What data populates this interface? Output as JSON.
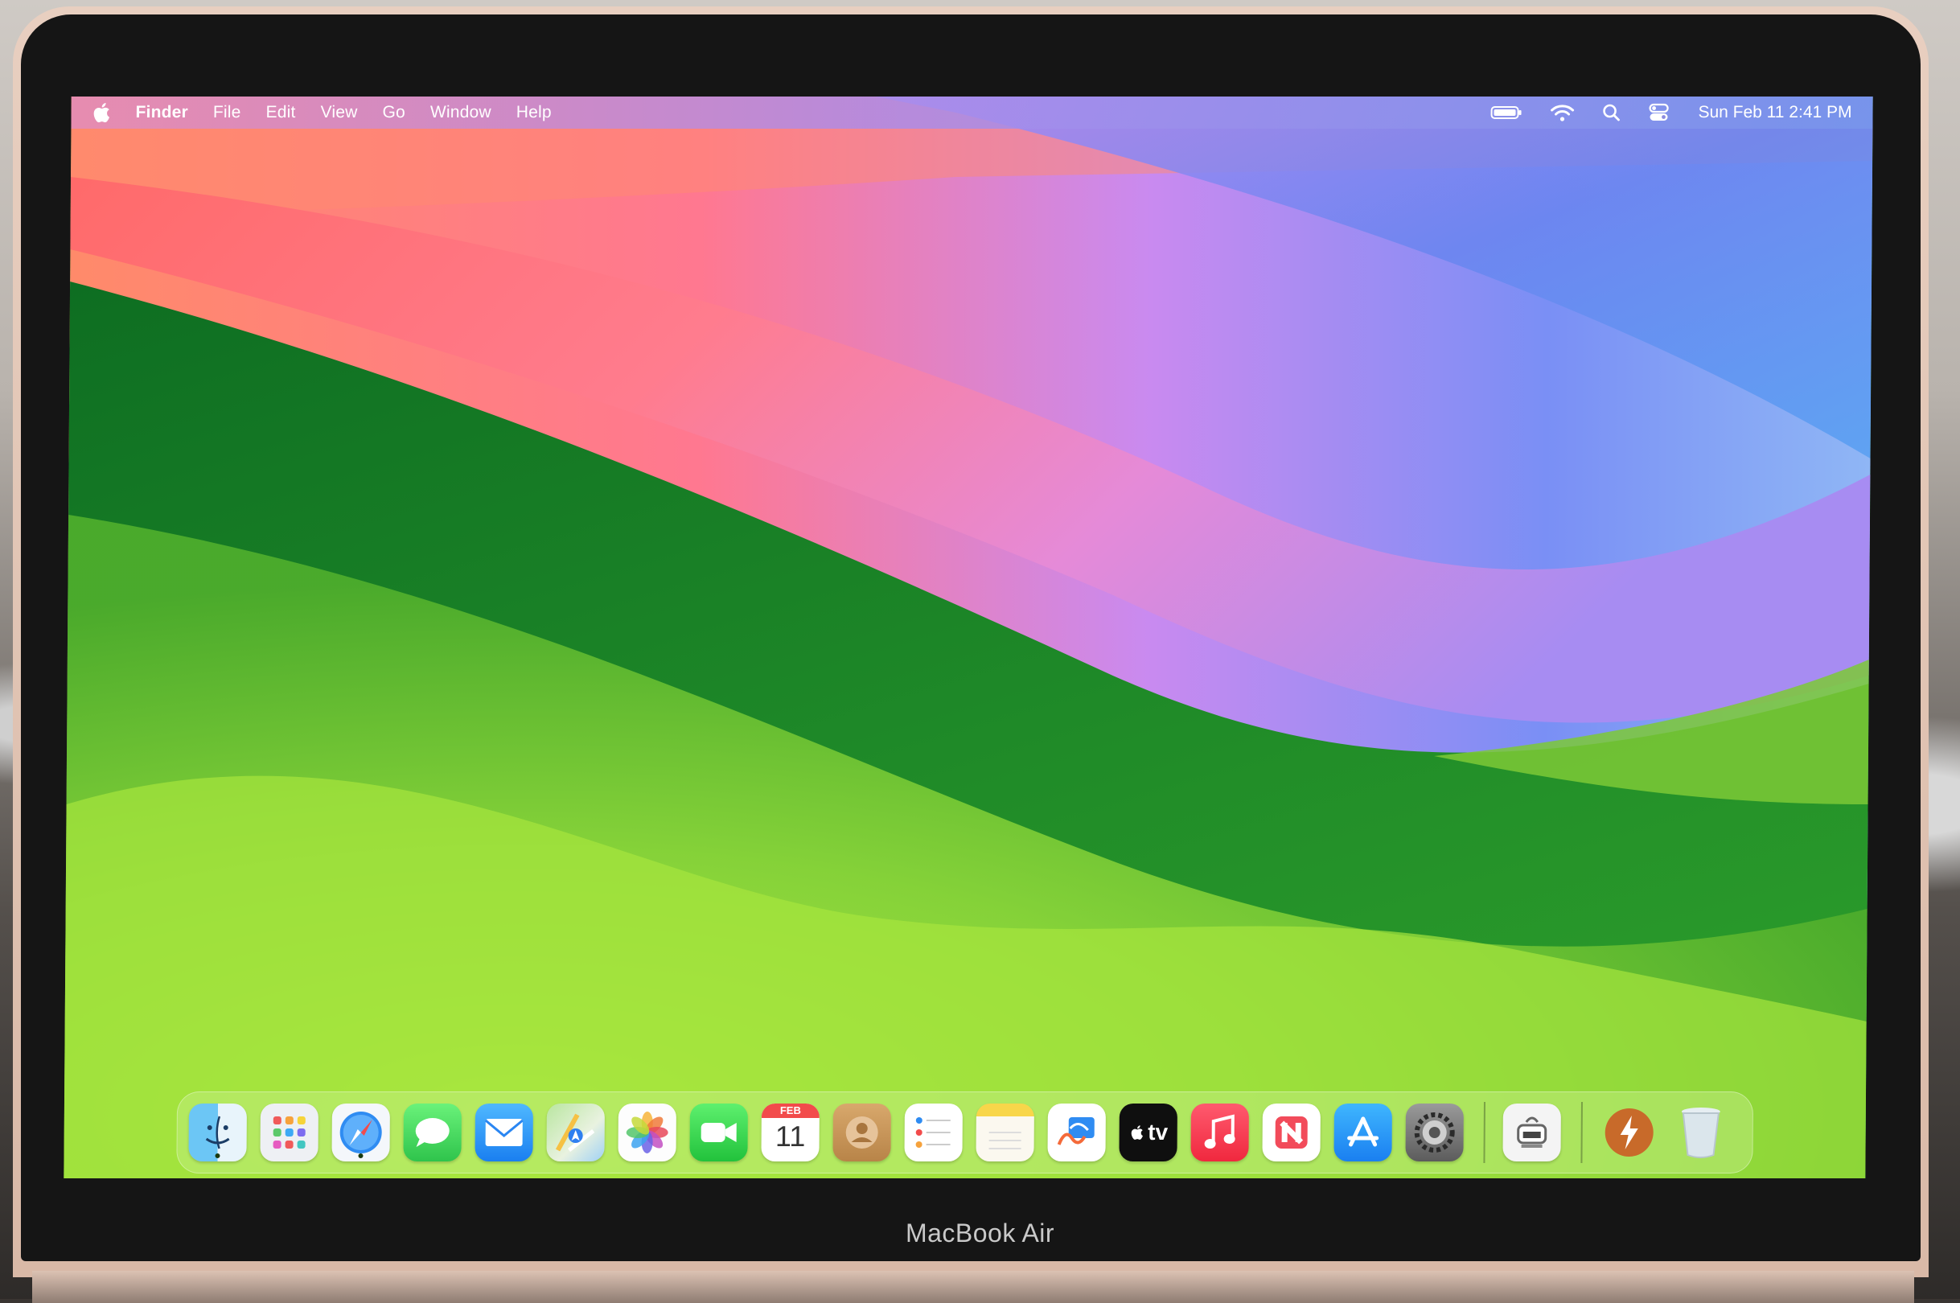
{
  "menubar": {
    "app_name": "Finder",
    "items": [
      "File",
      "Edit",
      "View",
      "Go",
      "Window",
      "Help"
    ],
    "clock": "Sun Feb 11  2:41 PM",
    "status_icons": [
      "battery-icon",
      "wifi-icon",
      "spotlight-search-icon",
      "control-center-icon"
    ]
  },
  "dock": {
    "apps": [
      {
        "name": "finder-icon",
        "running": true
      },
      {
        "name": "launchpad-icon",
        "running": false
      },
      {
        "name": "safari-icon",
        "running": true
      },
      {
        "name": "messages-icon",
        "running": false
      },
      {
        "name": "mail-icon",
        "running": false
      },
      {
        "name": "maps-icon",
        "running": false
      },
      {
        "name": "photos-icon",
        "running": false
      },
      {
        "name": "facetime-icon",
        "running": false
      },
      {
        "name": "calendar-icon",
        "running": false
      },
      {
        "name": "contacts-icon",
        "running": false
      },
      {
        "name": "reminders-icon",
        "running": false
      },
      {
        "name": "notes-icon",
        "running": false
      },
      {
        "name": "freeform-icon",
        "running": false
      },
      {
        "name": "apple-tv-icon",
        "running": false
      },
      {
        "name": "music-icon",
        "running": false
      },
      {
        "name": "news-icon",
        "running": false
      },
      {
        "name": "app-store-icon",
        "running": false
      },
      {
        "name": "system-settings-icon",
        "running": false
      }
    ],
    "calendar_month": "FEB",
    "calendar_day": "11",
    "tv_label": "tv",
    "extra": [
      "system-information-icon",
      "quick-launch-icon",
      "trash-icon"
    ]
  },
  "device": {
    "brand": "MacBook Air"
  },
  "colors": {
    "accent_green": "#4caf28",
    "menubar_tint": "#b28ce6"
  }
}
